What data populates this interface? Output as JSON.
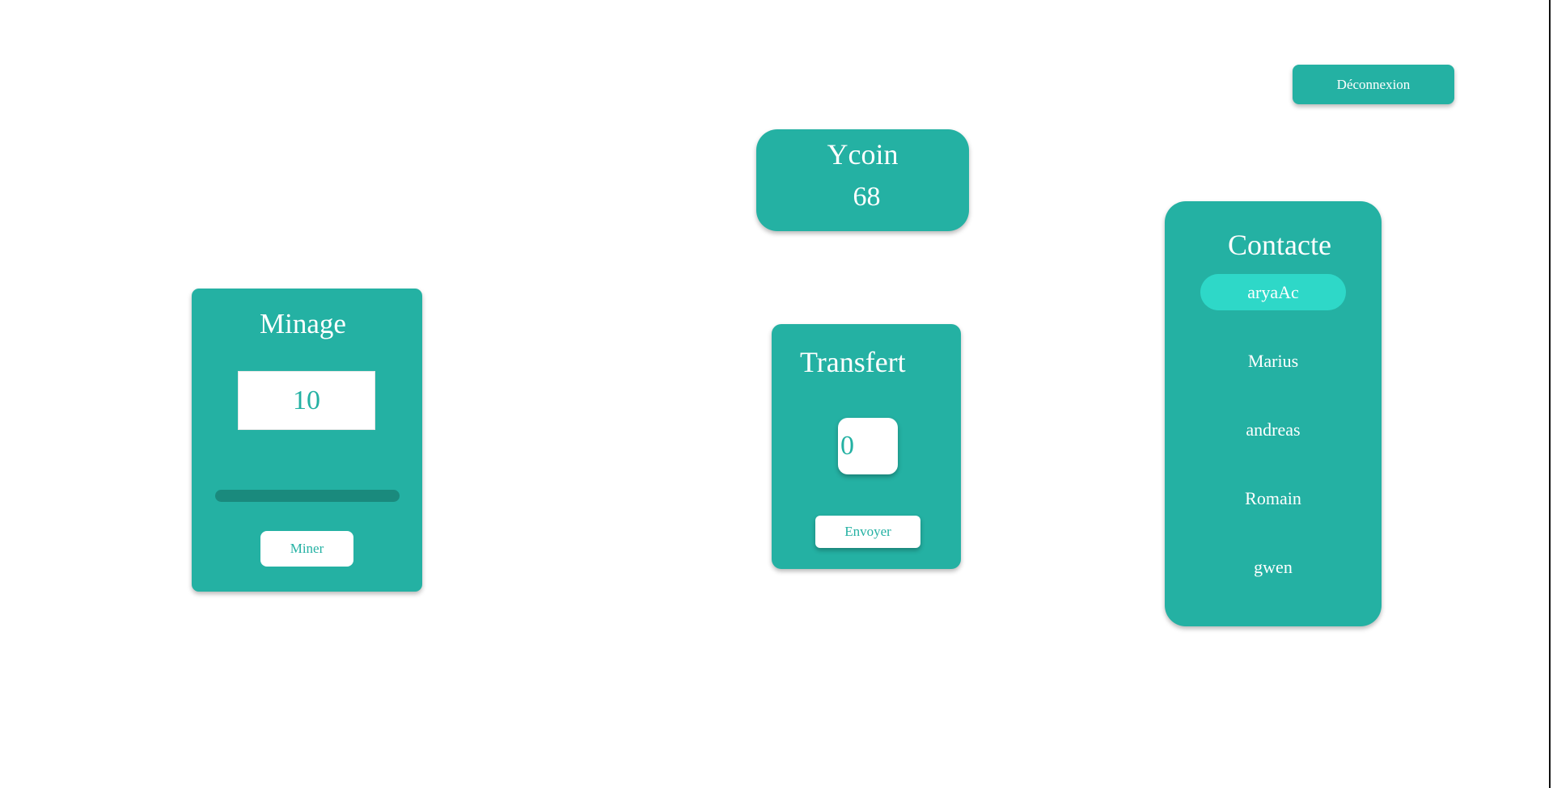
{
  "header": {
    "logout_label": "Déconnexion"
  },
  "balance": {
    "title": "Ycoin",
    "value": "68"
  },
  "mining": {
    "title": "Minage",
    "amount": "10",
    "progress": 0,
    "mine_label": "Miner"
  },
  "transfer": {
    "title": "Transfert",
    "amount": "0",
    "send_label": "Envoyer"
  },
  "contacts": {
    "title": "Contacte",
    "items": [
      {
        "label": "aryaAc",
        "selected": true
      },
      {
        "label": "Marius",
        "selected": false
      },
      {
        "label": "andreas",
        "selected": false
      },
      {
        "label": "Romain",
        "selected": false
      },
      {
        "label": "gwen",
        "selected": false
      }
    ]
  },
  "colors": {
    "primary": "#24b1a3",
    "selected": "#2ed8c8",
    "progress_track": "#1a8a7d",
    "text_light": "#ffffff"
  }
}
